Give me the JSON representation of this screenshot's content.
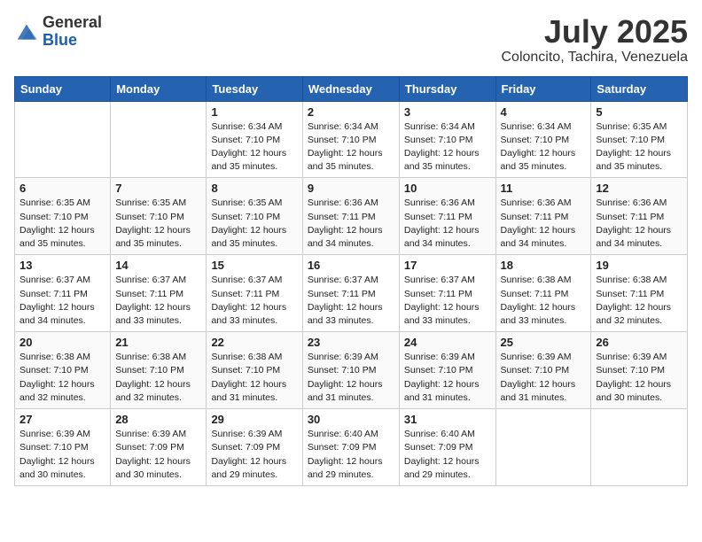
{
  "logo": {
    "text_general": "General",
    "text_blue": "Blue"
  },
  "title": {
    "month_year": "July 2025",
    "location": "Coloncito, Tachira, Venezuela"
  },
  "weekdays": [
    "Sunday",
    "Monday",
    "Tuesday",
    "Wednesday",
    "Thursday",
    "Friday",
    "Saturday"
  ],
  "weeks": [
    [
      {
        "day": "",
        "info": ""
      },
      {
        "day": "",
        "info": ""
      },
      {
        "day": "1",
        "info": "Sunrise: 6:34 AM\nSunset: 7:10 PM\nDaylight: 12 hours and 35 minutes."
      },
      {
        "day": "2",
        "info": "Sunrise: 6:34 AM\nSunset: 7:10 PM\nDaylight: 12 hours and 35 minutes."
      },
      {
        "day": "3",
        "info": "Sunrise: 6:34 AM\nSunset: 7:10 PM\nDaylight: 12 hours and 35 minutes."
      },
      {
        "day": "4",
        "info": "Sunrise: 6:34 AM\nSunset: 7:10 PM\nDaylight: 12 hours and 35 minutes."
      },
      {
        "day": "5",
        "info": "Sunrise: 6:35 AM\nSunset: 7:10 PM\nDaylight: 12 hours and 35 minutes."
      }
    ],
    [
      {
        "day": "6",
        "info": "Sunrise: 6:35 AM\nSunset: 7:10 PM\nDaylight: 12 hours and 35 minutes."
      },
      {
        "day": "7",
        "info": "Sunrise: 6:35 AM\nSunset: 7:10 PM\nDaylight: 12 hours and 35 minutes."
      },
      {
        "day": "8",
        "info": "Sunrise: 6:35 AM\nSunset: 7:10 PM\nDaylight: 12 hours and 35 minutes."
      },
      {
        "day": "9",
        "info": "Sunrise: 6:36 AM\nSunset: 7:11 PM\nDaylight: 12 hours and 34 minutes."
      },
      {
        "day": "10",
        "info": "Sunrise: 6:36 AM\nSunset: 7:11 PM\nDaylight: 12 hours and 34 minutes."
      },
      {
        "day": "11",
        "info": "Sunrise: 6:36 AM\nSunset: 7:11 PM\nDaylight: 12 hours and 34 minutes."
      },
      {
        "day": "12",
        "info": "Sunrise: 6:36 AM\nSunset: 7:11 PM\nDaylight: 12 hours and 34 minutes."
      }
    ],
    [
      {
        "day": "13",
        "info": "Sunrise: 6:37 AM\nSunset: 7:11 PM\nDaylight: 12 hours and 34 minutes."
      },
      {
        "day": "14",
        "info": "Sunrise: 6:37 AM\nSunset: 7:11 PM\nDaylight: 12 hours and 33 minutes."
      },
      {
        "day": "15",
        "info": "Sunrise: 6:37 AM\nSunset: 7:11 PM\nDaylight: 12 hours and 33 minutes."
      },
      {
        "day": "16",
        "info": "Sunrise: 6:37 AM\nSunset: 7:11 PM\nDaylight: 12 hours and 33 minutes."
      },
      {
        "day": "17",
        "info": "Sunrise: 6:37 AM\nSunset: 7:11 PM\nDaylight: 12 hours and 33 minutes."
      },
      {
        "day": "18",
        "info": "Sunrise: 6:38 AM\nSunset: 7:11 PM\nDaylight: 12 hours and 33 minutes."
      },
      {
        "day": "19",
        "info": "Sunrise: 6:38 AM\nSunset: 7:11 PM\nDaylight: 12 hours and 32 minutes."
      }
    ],
    [
      {
        "day": "20",
        "info": "Sunrise: 6:38 AM\nSunset: 7:10 PM\nDaylight: 12 hours and 32 minutes."
      },
      {
        "day": "21",
        "info": "Sunrise: 6:38 AM\nSunset: 7:10 PM\nDaylight: 12 hours and 32 minutes."
      },
      {
        "day": "22",
        "info": "Sunrise: 6:38 AM\nSunset: 7:10 PM\nDaylight: 12 hours and 31 minutes."
      },
      {
        "day": "23",
        "info": "Sunrise: 6:39 AM\nSunset: 7:10 PM\nDaylight: 12 hours and 31 minutes."
      },
      {
        "day": "24",
        "info": "Sunrise: 6:39 AM\nSunset: 7:10 PM\nDaylight: 12 hours and 31 minutes."
      },
      {
        "day": "25",
        "info": "Sunrise: 6:39 AM\nSunset: 7:10 PM\nDaylight: 12 hours and 31 minutes."
      },
      {
        "day": "26",
        "info": "Sunrise: 6:39 AM\nSunset: 7:10 PM\nDaylight: 12 hours and 30 minutes."
      }
    ],
    [
      {
        "day": "27",
        "info": "Sunrise: 6:39 AM\nSunset: 7:10 PM\nDaylight: 12 hours and 30 minutes."
      },
      {
        "day": "28",
        "info": "Sunrise: 6:39 AM\nSunset: 7:09 PM\nDaylight: 12 hours and 30 minutes."
      },
      {
        "day": "29",
        "info": "Sunrise: 6:39 AM\nSunset: 7:09 PM\nDaylight: 12 hours and 29 minutes."
      },
      {
        "day": "30",
        "info": "Sunrise: 6:40 AM\nSunset: 7:09 PM\nDaylight: 12 hours and 29 minutes."
      },
      {
        "day": "31",
        "info": "Sunrise: 6:40 AM\nSunset: 7:09 PM\nDaylight: 12 hours and 29 minutes."
      },
      {
        "day": "",
        "info": ""
      },
      {
        "day": "",
        "info": ""
      }
    ]
  ]
}
